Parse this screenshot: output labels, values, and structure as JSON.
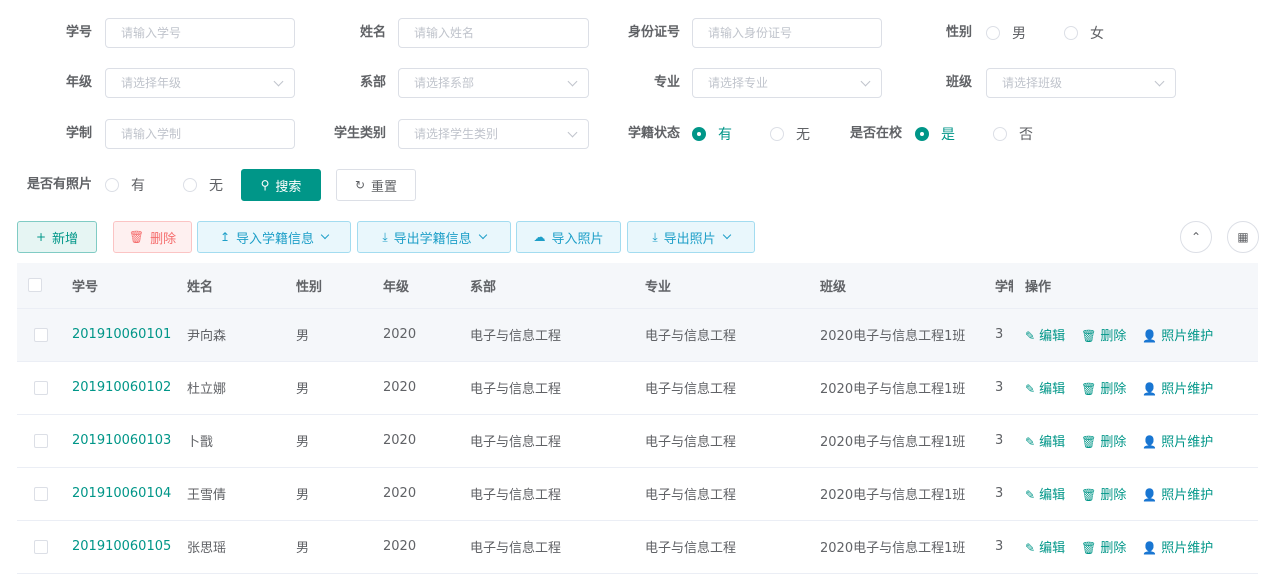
{
  "filters": {
    "sid": {
      "label": "学号",
      "placeholder": "请输入学号"
    },
    "name": {
      "label": "姓名",
      "placeholder": "请输入姓名"
    },
    "idcard": {
      "label": "身份证号",
      "placeholder": "请输入身份证号"
    },
    "gender": {
      "label": "性别",
      "options": [
        "男",
        "女"
      ],
      "selected": null
    },
    "grade": {
      "label": "年级",
      "placeholder": "请选择年级"
    },
    "dept": {
      "label": "系部",
      "placeholder": "请选择系部"
    },
    "major": {
      "label": "专业",
      "placeholder": "请选择专业"
    },
    "clazz": {
      "label": "班级",
      "placeholder": "请选择班级"
    },
    "system": {
      "label": "学制",
      "placeholder": "请输入学制"
    },
    "category": {
      "label": "学生类别",
      "placeholder": "请选择学生类别"
    },
    "status": {
      "label": "学籍状态",
      "options": [
        "有",
        "无"
      ],
      "selected": "有"
    },
    "inschool": {
      "label": "是否在校",
      "options": [
        "是",
        "否"
      ],
      "selected": "是"
    },
    "photo": {
      "label": "是否有照片",
      "options": [
        "有",
        "无"
      ],
      "selected": null
    }
  },
  "buttons": {
    "search": "搜索",
    "reset": "重置",
    "add": "新增",
    "delete": "删除",
    "import_info": "导入学籍信息",
    "export_info": "导出学籍信息",
    "import_photo": "导入照片",
    "export_photo": "导出照片"
  },
  "table": {
    "headers": [
      "学号",
      "姓名",
      "性别",
      "年级",
      "系部",
      "专业",
      "班级",
      "学制",
      "操作"
    ],
    "rows": [
      {
        "sid": "201910060101",
        "name": "尹向森",
        "gender": "男",
        "grade": "2020",
        "dept": "电子与信息工程",
        "major": "电子与信息工程",
        "clazz": "2020电子与信息工程1班",
        "system": "3"
      },
      {
        "sid": "201910060102",
        "name": "杜立娜",
        "gender": "男",
        "grade": "2020",
        "dept": "电子与信息工程",
        "major": "电子与信息工程",
        "clazz": "2020电子与信息工程1班",
        "system": "3"
      },
      {
        "sid": "201910060103",
        "name": "卜戬",
        "gender": "男",
        "grade": "2020",
        "dept": "电子与信息工程",
        "major": "电子与信息工程",
        "clazz": "2020电子与信息工程1班",
        "system": "3"
      },
      {
        "sid": "201910060104",
        "name": "王雪倩",
        "gender": "男",
        "grade": "2020",
        "dept": "电子与信息工程",
        "major": "电子与信息工程",
        "clazz": "2020电子与信息工程1班",
        "system": "3"
      },
      {
        "sid": "201910060105",
        "name": "张思瑶",
        "gender": "男",
        "grade": "2020",
        "dept": "电子与信息工程",
        "major": "电子与信息工程",
        "clazz": "2020电子与信息工程1班",
        "system": "3"
      }
    ],
    "ops": {
      "edit": "编辑",
      "delete": "删除",
      "photo": "照片维护"
    }
  },
  "colors": {
    "primary": "#009688",
    "danger": "#f56c6c",
    "info": "#1e9fc8"
  }
}
